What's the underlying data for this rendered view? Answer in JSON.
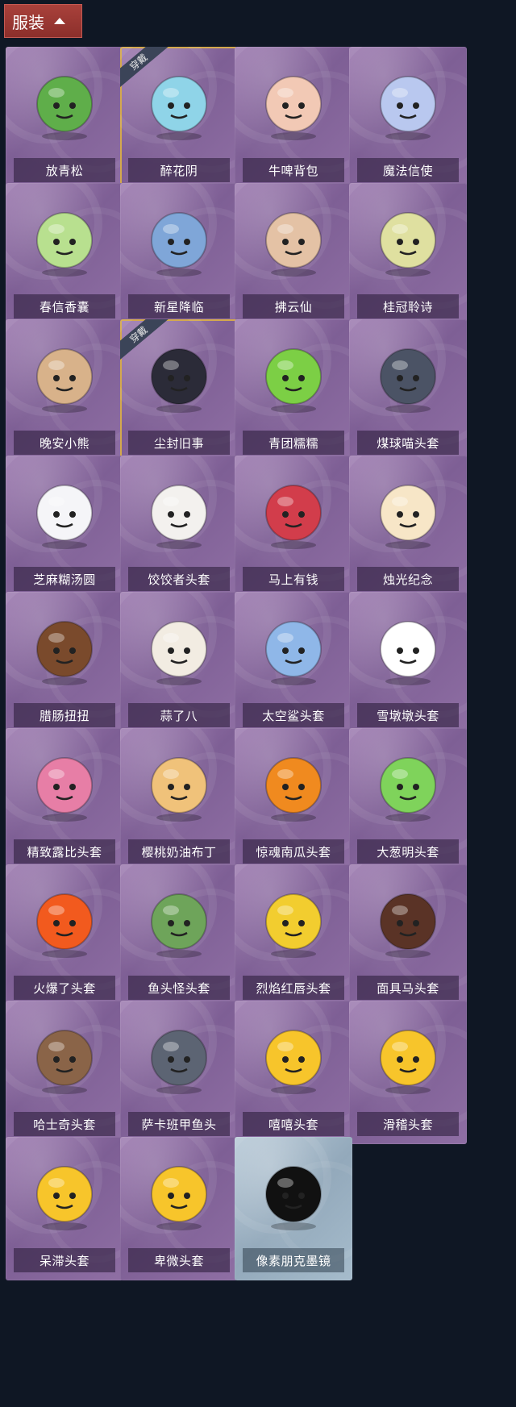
{
  "header": {
    "label": "服装",
    "icon": "chevron-up-icon"
  },
  "tags": {
    "equipped": "穿戴"
  },
  "items": [
    {
      "name": "放青松",
      "icon": "bonsai-tree-icon",
      "color": "#5fae4a",
      "equipped": false
    },
    {
      "name": "醉花阴",
      "icon": "dreamcatcher-icon",
      "color": "#8fd4e8",
      "equipped": true
    },
    {
      "name": "牛啤背包",
      "icon": "cow-barrel-icon",
      "color": "#f2c9b5",
      "equipped": false
    },
    {
      "name": "魔法信使",
      "icon": "elephant-icon",
      "color": "#b9c8ef",
      "equipped": false
    },
    {
      "name": "春信香囊",
      "icon": "sachet-icon",
      "color": "#b8e08f",
      "equipped": false
    },
    {
      "name": "新星降临",
      "icon": "doll-charm-icon",
      "color": "#7fa6d8",
      "equipped": false
    },
    {
      "name": "拂云仙",
      "icon": "fairy-charm-icon",
      "color": "#e4c2a5",
      "equipped": false
    },
    {
      "name": "桂冠聆诗",
      "icon": "laurel-charm-icon",
      "color": "#dfe0a0",
      "equipped": false
    },
    {
      "name": "晚安小熊",
      "icon": "teddy-bear-icon",
      "color": "#d8b28a",
      "equipped": false
    },
    {
      "name": "尘封旧事",
      "icon": "prince-charm-icon",
      "color": "#2b2b38",
      "equipped": true
    },
    {
      "name": "青团糯糯",
      "icon": "green-mochi-icon",
      "color": "#7ccf45",
      "equipped": false
    },
    {
      "name": "煤球喵头套",
      "icon": "black-cat-icon",
      "color": "#4b5365",
      "equipped": false
    },
    {
      "name": "芝麻糊汤圆",
      "icon": "dumpling-icon",
      "color": "#f5f5f8",
      "equipped": false
    },
    {
      "name": "饺饺者头套",
      "icon": "cloud-dumpling-icon",
      "color": "#f3f1ee",
      "equipped": false
    },
    {
      "name": "马上有钱",
      "icon": "red-horse-icon",
      "color": "#d23d4b",
      "equipped": false
    },
    {
      "name": "烛光纪念",
      "icon": "candle-icon",
      "color": "#f7e6c7",
      "equipped": false
    },
    {
      "name": "腊肠扭扭",
      "icon": "dachshund-icon",
      "color": "#7a4a2c",
      "equipped": false
    },
    {
      "name": "蒜了八",
      "icon": "garlic-icon",
      "color": "#f2ece2",
      "equipped": false
    },
    {
      "name": "太空鲨头套",
      "icon": "shark-icon",
      "color": "#8fb7e8",
      "equipped": false
    },
    {
      "name": "雪墩墩头套",
      "icon": "snowman-icon",
      "color": "#ffffff",
      "equipped": false
    },
    {
      "name": "精致露比头套",
      "icon": "pink-blob-icon",
      "color": "#e77ea6",
      "equipped": false
    },
    {
      "name": "樱桃奶油布丁",
      "icon": "pudding-icon",
      "color": "#f0c27a",
      "equipped": false
    },
    {
      "name": "惊魂南瓜头套",
      "icon": "pumpkin-icon",
      "color": "#f08a1f",
      "equipped": false
    },
    {
      "name": "大葱明头套",
      "icon": "scallion-icon",
      "color": "#7fd35b",
      "equipped": false
    },
    {
      "name": "火爆了头套",
      "icon": "fireball-icon",
      "color": "#f25a1e",
      "equipped": false
    },
    {
      "name": "鱼头怪头套",
      "icon": "fish-head-icon",
      "color": "#6ea45a",
      "equipped": false
    },
    {
      "name": "烈焰红唇头套",
      "icon": "yellow-mask-icon",
      "color": "#f2cd2f",
      "equipped": false
    },
    {
      "name": "面具马头套",
      "icon": "horse-mask-icon",
      "color": "#5a3326",
      "equipped": false
    },
    {
      "name": "哈士奇头套",
      "icon": "husky-icon",
      "color": "#8a6448",
      "equipped": false
    },
    {
      "name": "萨卡班甲鱼头",
      "icon": "sacabambaspis-icon",
      "color": "#5c6473",
      "equipped": false
    },
    {
      "name": "嘻嘻头套",
      "icon": "grin-emoji-icon",
      "color": "#f7c52b",
      "equipped": false
    },
    {
      "name": "滑稽头套",
      "icon": "smirk-emoji-icon",
      "color": "#f7c52b",
      "equipped": false
    },
    {
      "name": "呆滞头套",
      "icon": "dazed-emoji-icon",
      "color": "#f7c52b",
      "equipped": false
    },
    {
      "name": "卑微头套",
      "icon": "shy-emoji-icon",
      "color": "#f7c52b",
      "equipped": false
    },
    {
      "name": "像素朋克墨镜",
      "icon": "pixel-sunglasses-icon",
      "color": "#111111",
      "equipped": false,
      "theme": "blue"
    }
  ]
}
